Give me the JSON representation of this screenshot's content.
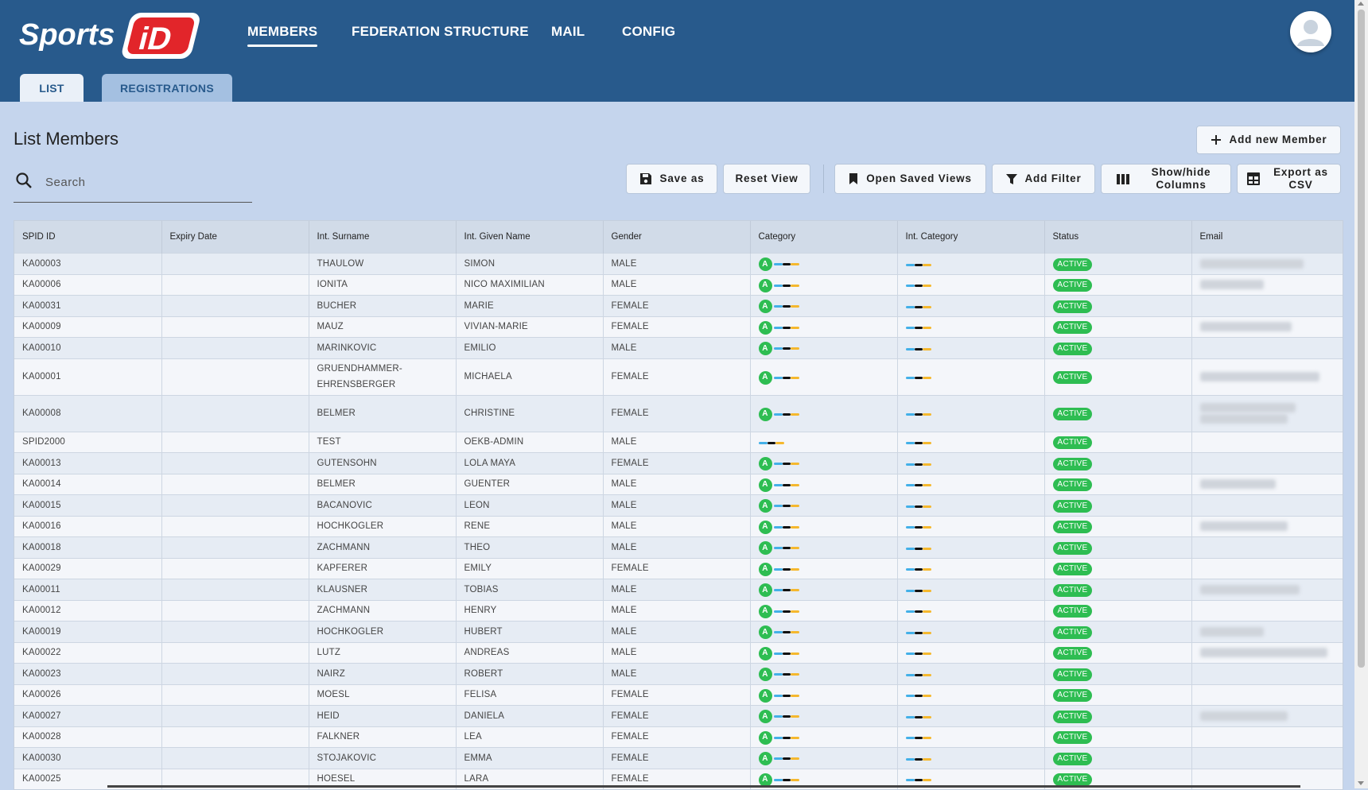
{
  "app": {
    "logo_text": "SportsID"
  },
  "nav": {
    "items": [
      "MEMBERS",
      "FEDERATION STRUCTURE",
      "MAIL",
      "CONFIG"
    ],
    "active": "MEMBERS"
  },
  "tabs": [
    "LIST",
    "REGISTRATIONS"
  ],
  "page": {
    "title": "List Members"
  },
  "actions": {
    "add_member": "Add new Member",
    "save_as": "Save as",
    "reset_view": "Reset View",
    "open_saved_views": "Open Saved Views",
    "add_filter": "Add Filter",
    "show_hide_columns": "Show/hide Columns",
    "export_csv": "Export as CSV"
  },
  "search": {
    "placeholder": "Search",
    "value": ""
  },
  "table": {
    "columns": [
      "SPID ID",
      "Expiry Date",
      "Int. Surname",
      "Int. Given Name",
      "Gender",
      "Category",
      "Int. Category",
      "Status",
      "Email"
    ],
    "rows": [
      {
        "spid": "KA00003",
        "expiry": "",
        "surname": "THAULOW",
        "given": "SIMON",
        "gender": "MALE",
        "category": "A",
        "status": "ACTIVE",
        "email_hidden": true
      },
      {
        "spid": "KA00006",
        "expiry": "",
        "surname": "IONITA",
        "given": "NICO MAXIMILIAN",
        "gender": "MALE",
        "category": "A",
        "status": "ACTIVE",
        "email_hidden": true
      },
      {
        "spid": "KA00031",
        "expiry": "",
        "surname": "BUCHER",
        "given": "MARIE",
        "gender": "FEMALE",
        "category": "A",
        "status": "ACTIVE",
        "email_hidden": false
      },
      {
        "spid": "KA00009",
        "expiry": "",
        "surname": "MAUZ",
        "given": "VIVIAN-MARIE",
        "gender": "FEMALE",
        "category": "A",
        "status": "ACTIVE",
        "email_hidden": true
      },
      {
        "spid": "KA00010",
        "expiry": "",
        "surname": "MARINKOVIC",
        "given": "EMILIO",
        "gender": "MALE",
        "category": "A",
        "status": "ACTIVE",
        "email_hidden": false
      },
      {
        "spid": "KA00001",
        "expiry": "",
        "surname": "GRUENDHAMMER-EHRENSBERGER",
        "given": "MICHAELA",
        "gender": "FEMALE",
        "category": "A",
        "status": "ACTIVE",
        "email_hidden": true,
        "tall": true
      },
      {
        "spid": "KA00008",
        "expiry": "",
        "surname": "BELMER",
        "given": "CHRISTINE",
        "gender": "FEMALE",
        "category": "A",
        "status": "ACTIVE",
        "email_hidden": true,
        "tall": true
      },
      {
        "spid": "SPID2000",
        "expiry": "",
        "surname": "TEST",
        "given": "OEKB-ADMIN",
        "gender": "MALE",
        "category": "",
        "status": "ACTIVE",
        "email_hidden": false
      },
      {
        "spid": "KA00013",
        "expiry": "",
        "surname": "GUTENSOHN",
        "given": "LOLA MAYA",
        "gender": "FEMALE",
        "category": "A",
        "status": "ACTIVE",
        "email_hidden": false
      },
      {
        "spid": "KA00014",
        "expiry": "",
        "surname": "BELMER",
        "given": "GUENTER",
        "gender": "MALE",
        "category": "A",
        "status": "ACTIVE",
        "email_hidden": true
      },
      {
        "spid": "KA00015",
        "expiry": "",
        "surname": "BACANOVIC",
        "given": "LEON",
        "gender": "MALE",
        "category": "A",
        "status": "ACTIVE",
        "email_hidden": false
      },
      {
        "spid": "KA00016",
        "expiry": "",
        "surname": "HOCHKOGLER",
        "given": "RENE",
        "gender": "MALE",
        "category": "A",
        "status": "ACTIVE",
        "email_hidden": true
      },
      {
        "spid": "KA00018",
        "expiry": "",
        "surname": "ZACHMANN",
        "given": "THEO",
        "gender": "MALE",
        "category": "A",
        "status": "ACTIVE",
        "email_hidden": false
      },
      {
        "spid": "KA00029",
        "expiry": "",
        "surname": "KAPFERER",
        "given": "EMILY",
        "gender": "FEMALE",
        "category": "A",
        "status": "ACTIVE",
        "email_hidden": false
      },
      {
        "spid": "KA00011",
        "expiry": "",
        "surname": "KLAUSNER",
        "given": "TOBIAS",
        "gender": "MALE",
        "category": "A",
        "status": "ACTIVE",
        "email_hidden": true
      },
      {
        "spid": "KA00012",
        "expiry": "",
        "surname": "ZACHMANN",
        "given": "HENRY",
        "gender": "MALE",
        "category": "A",
        "status": "ACTIVE",
        "email_hidden": false
      },
      {
        "spid": "KA00019",
        "expiry": "",
        "surname": "HOCHKOGLER",
        "given": "HUBERT",
        "gender": "MALE",
        "category": "A",
        "status": "ACTIVE",
        "email_hidden": true
      },
      {
        "spid": "KA00022",
        "expiry": "",
        "surname": "LUTZ",
        "given": "ANDREAS",
        "gender": "MALE",
        "category": "A",
        "status": "ACTIVE",
        "email_hidden": true
      },
      {
        "spid": "KA00023",
        "expiry": "",
        "surname": "NAIRZ",
        "given": "ROBERT",
        "gender": "MALE",
        "category": "A",
        "status": "ACTIVE",
        "email_hidden": false
      },
      {
        "spid": "KA00026",
        "expiry": "",
        "surname": "MOESL",
        "given": "FELISA",
        "gender": "FEMALE",
        "category": "A",
        "status": "ACTIVE",
        "email_hidden": false
      },
      {
        "spid": "KA00027",
        "expiry": "",
        "surname": "HEID",
        "given": "DANIELA",
        "gender": "FEMALE",
        "category": "A",
        "status": "ACTIVE",
        "email_hidden": true
      },
      {
        "spid": "KA00028",
        "expiry": "",
        "surname": "FALKNER",
        "given": "LEA",
        "gender": "FEMALE",
        "category": "A",
        "status": "ACTIVE",
        "email_hidden": false
      },
      {
        "spid": "KA00030",
        "expiry": "",
        "surname": "STOJAKOVIC",
        "given": "EMMA",
        "gender": "FEMALE",
        "category": "A",
        "status": "ACTIVE",
        "email_hidden": false
      },
      {
        "spid": "KA00025",
        "expiry": "",
        "surname": "HOESEL",
        "given": "LARA",
        "gender": "FEMALE",
        "category": "A",
        "status": "ACTIVE",
        "email_hidden": false
      }
    ]
  },
  "colors": {
    "primary": "#285a8c",
    "background": "#c5d5ed",
    "active_badge": "#2ebd52"
  }
}
